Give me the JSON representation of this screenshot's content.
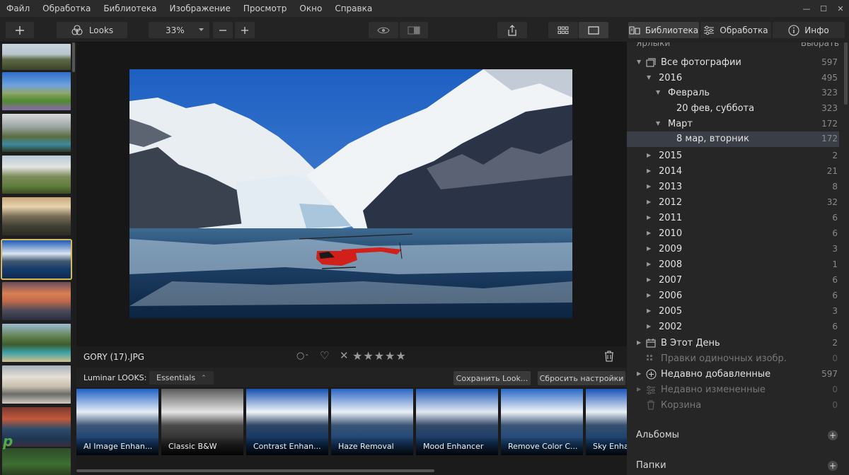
{
  "menu": [
    "Файл",
    "Обработка",
    "Библиотека",
    "Изображение",
    "Просмотр",
    "Окно",
    "Справка"
  ],
  "toolbar": {
    "looks_label": "Looks",
    "zoom_value": "33%",
    "zoom_out_icon": "minus-icon",
    "zoom_in_icon": "plus-icon"
  },
  "right_tabs": [
    {
      "label": "Библиотека",
      "icon": "library-icon",
      "active": true
    },
    {
      "label": "Обработка",
      "icon": "sliders-icon",
      "active": false
    },
    {
      "label": "Инфо",
      "icon": "info-icon",
      "active": false
    }
  ],
  "library": {
    "header": "Ярлыки",
    "select_label": "Выбрать",
    "rows": [
      {
        "label": "Все фотографии",
        "count": "597",
        "icon": "photos-icon"
      },
      {
        "label": "2016",
        "count": "495"
      },
      {
        "label": "Февраль",
        "count": "323"
      },
      {
        "label": "20 фев, суббота",
        "count": "323"
      },
      {
        "label": "Март",
        "count": "172"
      },
      {
        "label": "8 мар, вторник",
        "count": "172"
      },
      {
        "label": "2015",
        "count": "2"
      },
      {
        "label": "2014",
        "count": "21"
      },
      {
        "label": "2013",
        "count": "8"
      },
      {
        "label": "2012",
        "count": "32"
      },
      {
        "label": "2011",
        "count": "6"
      },
      {
        "label": "2010",
        "count": "6"
      },
      {
        "label": "2009",
        "count": "3"
      },
      {
        "label": "2008",
        "count": "1"
      },
      {
        "label": "2007",
        "count": "6"
      },
      {
        "label": "2006",
        "count": "6"
      },
      {
        "label": "2005",
        "count": "3"
      },
      {
        "label": "2002",
        "count": "6"
      },
      {
        "label": "В Этот День",
        "count": "2",
        "icon": "calendar-icon"
      },
      {
        "label": "Правки одиночных изобр.",
        "count": "0",
        "icon": "edits-icon"
      },
      {
        "label": "Недавно добавленные",
        "count": "597",
        "icon": "add-circle-icon"
      },
      {
        "label": "Недавно измененные",
        "count": "0",
        "icon": "sliders-icon"
      },
      {
        "label": "Корзина",
        "count": "0",
        "icon": "trash-icon"
      }
    ],
    "albums_label": "Альбомы",
    "folders_label": "Папки"
  },
  "image": {
    "filename": "GORY (17).JPG"
  },
  "looks": {
    "label": "Luminar LOOKS:",
    "collection": "Essentials",
    "save_label": "Сохранить Look...",
    "reset_label": "Сбросить настройки",
    "items": [
      "AI Image Enhan...",
      "Classic B&W",
      "Contrast Enhan...",
      "Haze Removal",
      "Mood Enhancer",
      "Remove Color C...",
      "Sky Enha"
    ]
  },
  "watermark": "portal"
}
